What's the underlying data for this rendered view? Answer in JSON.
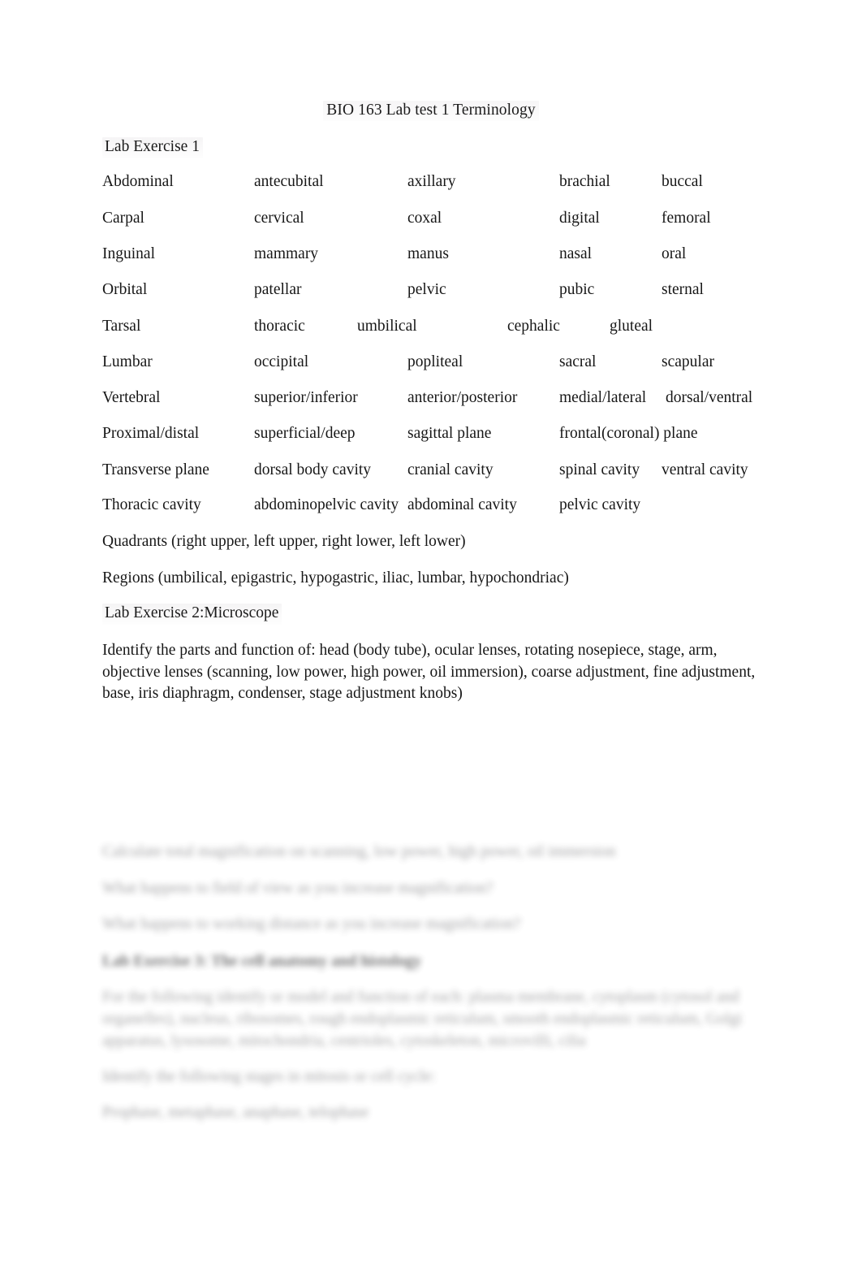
{
  "document": {
    "title": "BIO 163 Lab test 1 Terminology",
    "background_color": "#ffffff",
    "text_color": "#171717",
    "highlight_color": "#f5f4f5"
  },
  "sections": {
    "exercise_1_heading": "Lab Exercise 1",
    "exercise_2_heading": "Lab Exercise 2:Microscope",
    "quadrants_line": "Quadrants (right upper, left upper, right lower, left lower)",
    "regions_line": "Regions (umbilical, epigastric, hypogastric, iliac, lumbar, hypochondriac)"
  },
  "terminology_rows": [
    {
      "c1": "Abdominal",
      "c2": "antecubital",
      "c3": "axillary",
      "c4": "brachial",
      "c5": "buccal"
    },
    {
      "c1": "Carpal",
      "c2": "cervical",
      "c3": "coxal",
      "c4": "digital",
      "c5": "femoral"
    },
    {
      "c1": "Inguinal",
      "c2": "mammary",
      "c3": "manus",
      "c4": "nasal",
      "c5": "oral"
    },
    {
      "c1": "Orbital",
      "c2": "patellar",
      "c3": "pelvic",
      "c4": "pubic",
      "c5": "sternal"
    },
    {
      "c1": "Tarsal",
      "c2": "thoracic",
      "c3": "umbilical",
      "c4": "cephalic",
      "c5": "gluteal"
    },
    {
      "c1": "Lumbar",
      "c2": "occipital",
      "c3": "popliteal",
      "c4": "sacral",
      "c5": "scapular"
    },
    {
      "c1": "Vertebral",
      "c2": "superior/inferior",
      "c3": "anterior/posterior",
      "c4": "medial/lateral",
      "c5": "dorsal/ventral"
    },
    {
      "c1": "Proximal/distal",
      "c2": "superficial/deep",
      "c3": "sagittal plane",
      "c4": "frontal(coronal) plane",
      "c5": ""
    },
    {
      "c1": "Transverse plane",
      "c2": "dorsal body cavity",
      "c3": "cranial cavity",
      "c4": "spinal cavity",
      "c5": "ventral cavity"
    },
    {
      "c1": "Thoracic cavity",
      "c2": "abdominopelvic cavity",
      "c3": "abdominal cavity",
      "c4": "pelvic cavity",
      "c5": ""
    }
  ],
  "microscope_paragraph": {
    "line_1": "Identify the parts and function of:  head (body tube), ocular lenses, rotating nosepiece, stage, arm,",
    "line_2": "objective lenses (scanning, low power, high power, oil immersion), coarse adjustment, fine adjustment,",
    "line_3": "base, iris diaphragm, condenser, stage adjustment knobs)"
  },
  "obscured_section": {
    "note": "blurred / illegible text region",
    "line_1": "Calculate total magnification on scanning, low power, high power, oil immersion",
    "line_2": "What happens to field of view as you increase magnification?",
    "line_3": "What happens to working distance as you increase magnification?",
    "heading": "Lab Exercise 3: The cell anatomy and histology",
    "block_line_1": "For the following identify or model and function of each: plasma membrane, cytoplasm (cytosol and",
    "block_line_2": "organelles), nucleus, ribosomes, rough endoplasmic reticulum, smooth endoplasmic reticulum, Golgi",
    "block_line_3": "apparatus, lysosome, mitochondria, centrioles, cytoskeleton, microvilli, cilia",
    "line_4": "Identify the following stages in mitosis or cell cycle:",
    "line_5": "Prophase, metaphase, anaphase, telophase"
  }
}
